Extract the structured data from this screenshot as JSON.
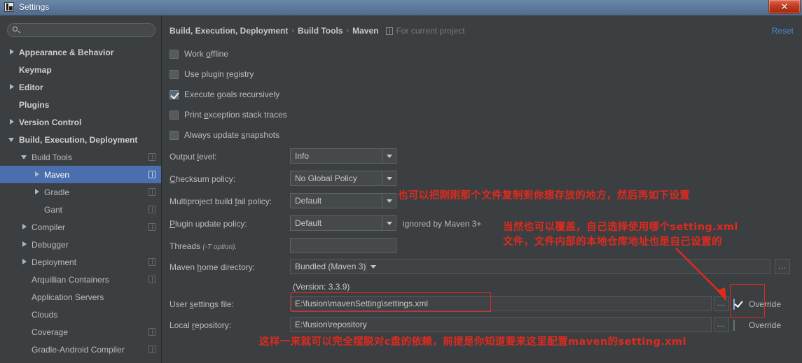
{
  "window": {
    "title": "Settings",
    "close_label": "✕",
    "app_icon": "intellij-idea-icon"
  },
  "sidebar": {
    "search_placeholder": "",
    "search_value": "",
    "items": [
      {
        "label": "Appearance & Behavior",
        "arrow": "right",
        "indent": 0,
        "bold": true,
        "project_icon": false,
        "selected": false
      },
      {
        "label": "Keymap",
        "arrow": "none",
        "indent": 0,
        "bold": true,
        "project_icon": false,
        "selected": false
      },
      {
        "label": "Editor",
        "arrow": "right",
        "indent": 0,
        "bold": true,
        "project_icon": false,
        "selected": false
      },
      {
        "label": "Plugins",
        "arrow": "none",
        "indent": 0,
        "bold": true,
        "project_icon": false,
        "selected": false
      },
      {
        "label": "Version Control",
        "arrow": "right",
        "indent": 0,
        "bold": true,
        "project_icon": false,
        "selected": false
      },
      {
        "label": "Build, Execution, Deployment",
        "arrow": "down",
        "indent": 0,
        "bold": true,
        "project_icon": false,
        "selected": false
      },
      {
        "label": "Build Tools",
        "arrow": "down",
        "indent": 1,
        "bold": false,
        "project_icon": true,
        "selected": false
      },
      {
        "label": "Maven",
        "arrow": "right",
        "indent": 2,
        "bold": false,
        "project_icon": true,
        "selected": true
      },
      {
        "label": "Gradle",
        "arrow": "right",
        "indent": 2,
        "bold": false,
        "project_icon": true,
        "selected": false
      },
      {
        "label": "Gant",
        "arrow": "none",
        "indent": 2,
        "bold": false,
        "project_icon": true,
        "selected": false
      },
      {
        "label": "Compiler",
        "arrow": "right",
        "indent": 1,
        "bold": false,
        "project_icon": true,
        "selected": false
      },
      {
        "label": "Debugger",
        "arrow": "right",
        "indent": 1,
        "bold": false,
        "project_icon": false,
        "selected": false
      },
      {
        "label": "Deployment",
        "arrow": "right",
        "indent": 1,
        "bold": false,
        "project_icon": true,
        "selected": false
      },
      {
        "label": "Arquillian Containers",
        "arrow": "none",
        "indent": 1,
        "bold": false,
        "project_icon": true,
        "selected": false
      },
      {
        "label": "Application Servers",
        "arrow": "none",
        "indent": 1,
        "bold": false,
        "project_icon": false,
        "selected": false
      },
      {
        "label": "Clouds",
        "arrow": "none",
        "indent": 1,
        "bold": false,
        "project_icon": false,
        "selected": false
      },
      {
        "label": "Coverage",
        "arrow": "none",
        "indent": 1,
        "bold": false,
        "project_icon": true,
        "selected": false
      },
      {
        "label": "Gradle-Android Compiler",
        "arrow": "none",
        "indent": 1,
        "bold": false,
        "project_icon": true,
        "selected": false
      }
    ]
  },
  "header": {
    "breadcrumb": [
      "Build, Execution, Deployment",
      "Build Tools",
      "Maven"
    ],
    "separator": "›",
    "scope": "For current project",
    "reset_label": "Reset"
  },
  "options": {
    "work_offline": {
      "label_pre": "Work ",
      "label_mnemonic": "o",
      "label_post": "ffline",
      "checked": false
    },
    "use_plugin_registry": {
      "label_pre": "Use plugin ",
      "label_mnemonic": "r",
      "label_post": "egistry",
      "checked": false
    },
    "execute_goals": {
      "label_pre": "Execute ",
      "label_mnemonic": "g",
      "label_post": "oals recursively",
      "checked": true
    },
    "print_exception": {
      "label_pre": "Print ",
      "label_mnemonic": "e",
      "label_post": "xception stack traces",
      "checked": false
    },
    "always_update": {
      "label_pre": "Always update ",
      "label_mnemonic": "s",
      "label_post": "napshots",
      "checked": false
    }
  },
  "fields": {
    "output_level": {
      "label_pre": "Output ",
      "label_mnemonic": "l",
      "label_post": "evel:",
      "value": "Info"
    },
    "checksum": {
      "label_pre": "",
      "label_mnemonic": "C",
      "label_post": "hecksum policy:",
      "value": "No Global Policy"
    },
    "multiproject": {
      "label_pre": "Multiproject build ",
      "label_mnemonic": "f",
      "label_post": "ail policy:",
      "value": "Default"
    },
    "plugin_update": {
      "label_pre": "",
      "label_mnemonic": "P",
      "label_post": "lugin update policy:",
      "value": "Default",
      "hint": "ignored by Maven 3+"
    },
    "threads": {
      "label_pre": "Threads ",
      "label_sub": "(-T option).",
      "value": ""
    },
    "maven_home": {
      "label_pre": "Maven ",
      "label_mnemonic": "h",
      "label_post": "ome directory:",
      "value": "Bundled (Maven 3)",
      "version_note": "(Version: 3.3.9)",
      "browse": "..."
    },
    "user_settings": {
      "label_pre": "User ",
      "label_mnemonic": "s",
      "label_post": "ettings file:",
      "value": "E:\\fusion\\mavenSetting\\settings.xml",
      "browse": "...",
      "override_label": "Override",
      "override_checked": true
    },
    "local_repo": {
      "label_pre": "Local ",
      "label_mnemonic": "r",
      "label_post": "epository:",
      "value": "E:\\fusion\\repository",
      "browse": "...",
      "override_label": "Override",
      "override_checked": false
    }
  },
  "annotations": {
    "color": "#e02a1e",
    "note_top": "也可以把刚刚那个文件复制到你想存放的地方，然后再如下设置",
    "note_mid_line1": "当然也可以覆盖，自己选择使用哪个setting.xml",
    "note_mid_line2": "文件，文件内部的本地仓库地址也是自己设置的",
    "note_bottom": "这样一来就可以完全摆脱对c盘的依赖，前提是你知道要来这里配置maven的setting.xml"
  }
}
